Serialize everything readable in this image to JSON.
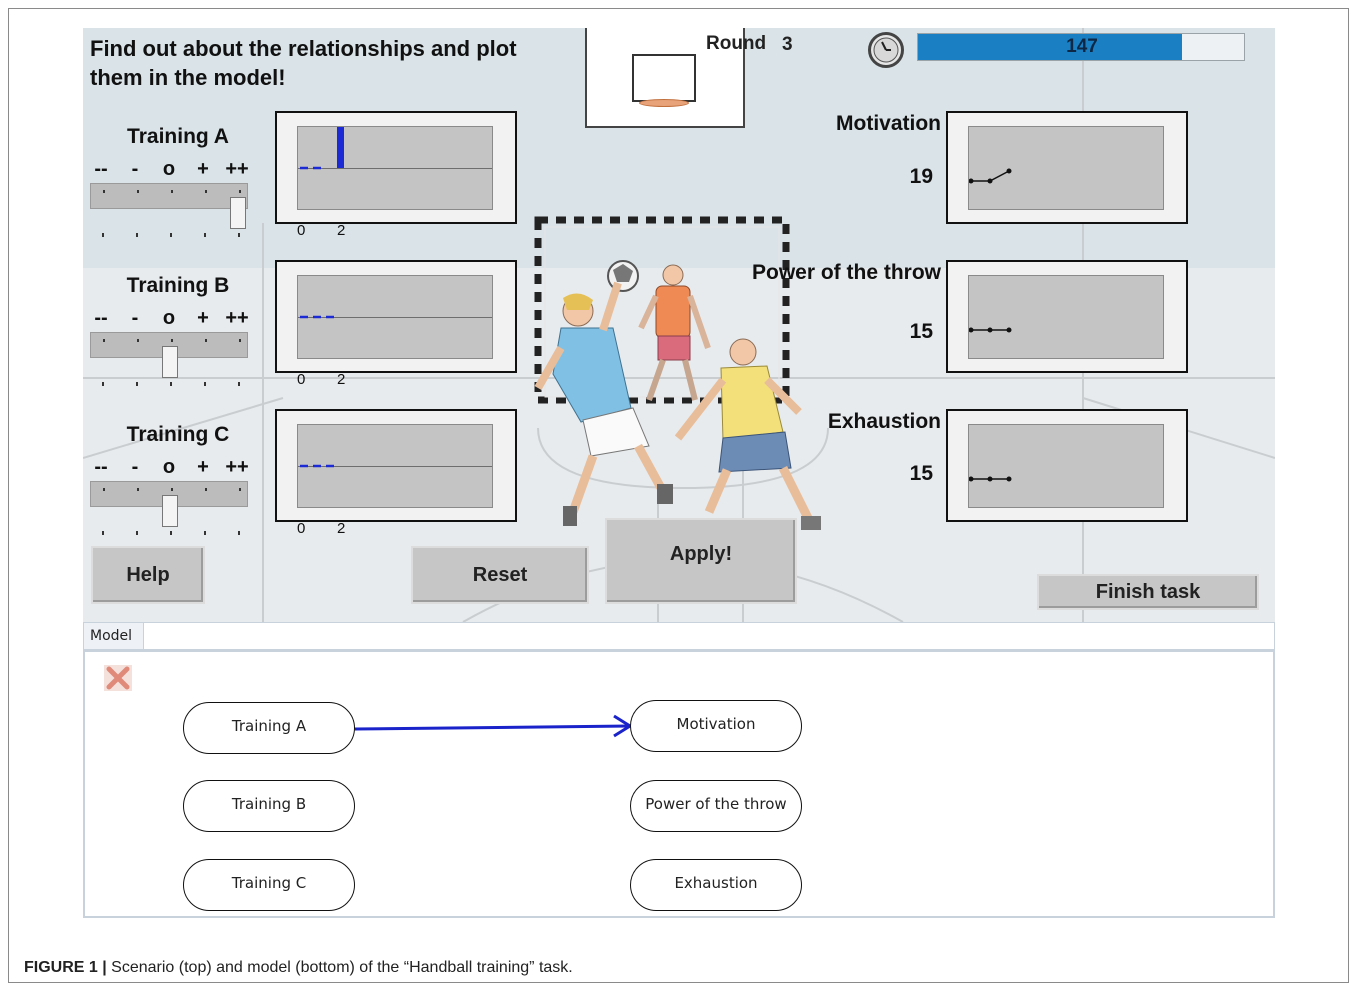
{
  "header": {
    "prompt": "Find out about the relationships and plot them in the model!",
    "round_label": "Round",
    "round_value": "3",
    "timer_value": "147",
    "timer_fraction": 0.81
  },
  "inputs": [
    {
      "title": "Training A",
      "slider_level": "++",
      "history": [
        0,
        0
      ],
      "current_bar": 2
    },
    {
      "title": "Training B",
      "slider_level": "o",
      "history": [
        0,
        0,
        0
      ],
      "current_bar": 0
    },
    {
      "title": "Training C",
      "slider_level": "o",
      "history": [
        0,
        0,
        0
      ],
      "current_bar": 0
    }
  ],
  "scale_labels": [
    "--",
    "-",
    "o",
    "+",
    "++"
  ],
  "axis_labels": [
    "0",
    "2"
  ],
  "outputs": [
    {
      "title": "Motivation",
      "value": "19",
      "history": [
        0,
        0,
        1
      ]
    },
    {
      "title": "Power of the throw",
      "value": "15",
      "history": [
        0,
        0,
        0
      ]
    },
    {
      "title": "Exhaustion",
      "value": "15",
      "history": [
        0,
        0,
        0
      ]
    }
  ],
  "buttons": {
    "help": "Help",
    "reset": "Reset",
    "apply": "Apply!",
    "finish": "Finish task"
  },
  "model": {
    "tab_label": "Model",
    "inputs": [
      "Training A",
      "Training B",
      "Training C"
    ],
    "outputs": [
      "Motivation",
      "Power of the throw",
      "Exhaustion"
    ],
    "edges": [
      {
        "from": "Training A",
        "to": "Motivation"
      }
    ],
    "edge_color": "#1a23c9"
  },
  "caption": {
    "label": "FIGURE 1 |",
    "text": "Scenario (top) and model (bottom) of the “Handball training” task."
  },
  "colors": {
    "timer": "#1b7fc4",
    "input_history": "#1c2ad6",
    "current_bar": "#1c2ad6"
  }
}
